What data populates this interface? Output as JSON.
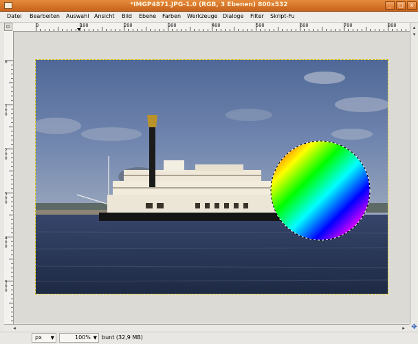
{
  "window": {
    "title": "*IMGP4871.JPG-1.0 (RGB, 3 Ebenen) 800x532",
    "buttons": [
      "_",
      "□",
      "x"
    ]
  },
  "menu": {
    "items": [
      "Datei",
      "Bearbeiten",
      "Auswahl",
      "Ansicht",
      "Bild",
      "Ebene",
      "Farben",
      "Werkzeuge",
      "Dialoge",
      "Filter",
      "Skript-Fu"
    ]
  },
  "ruler": {
    "h_labels": [
      "0",
      "100",
      "200",
      "300",
      "400",
      "500",
      "600",
      "700",
      "800"
    ],
    "v_labels": [
      "0",
      "100",
      "200",
      "300",
      "400",
      "500"
    ]
  },
  "colors": {
    "selection_outline": "#d6c400",
    "titlebar": "#d8731f",
    "navigate_icon": "#2d62b8"
  },
  "icons": {
    "ruler_corner": "quickmask-icon",
    "navigate": "navigate-icon"
  },
  "status": {
    "unit": "px",
    "zoom": "100%",
    "layer_info": "bunt (32,9 MB)"
  }
}
